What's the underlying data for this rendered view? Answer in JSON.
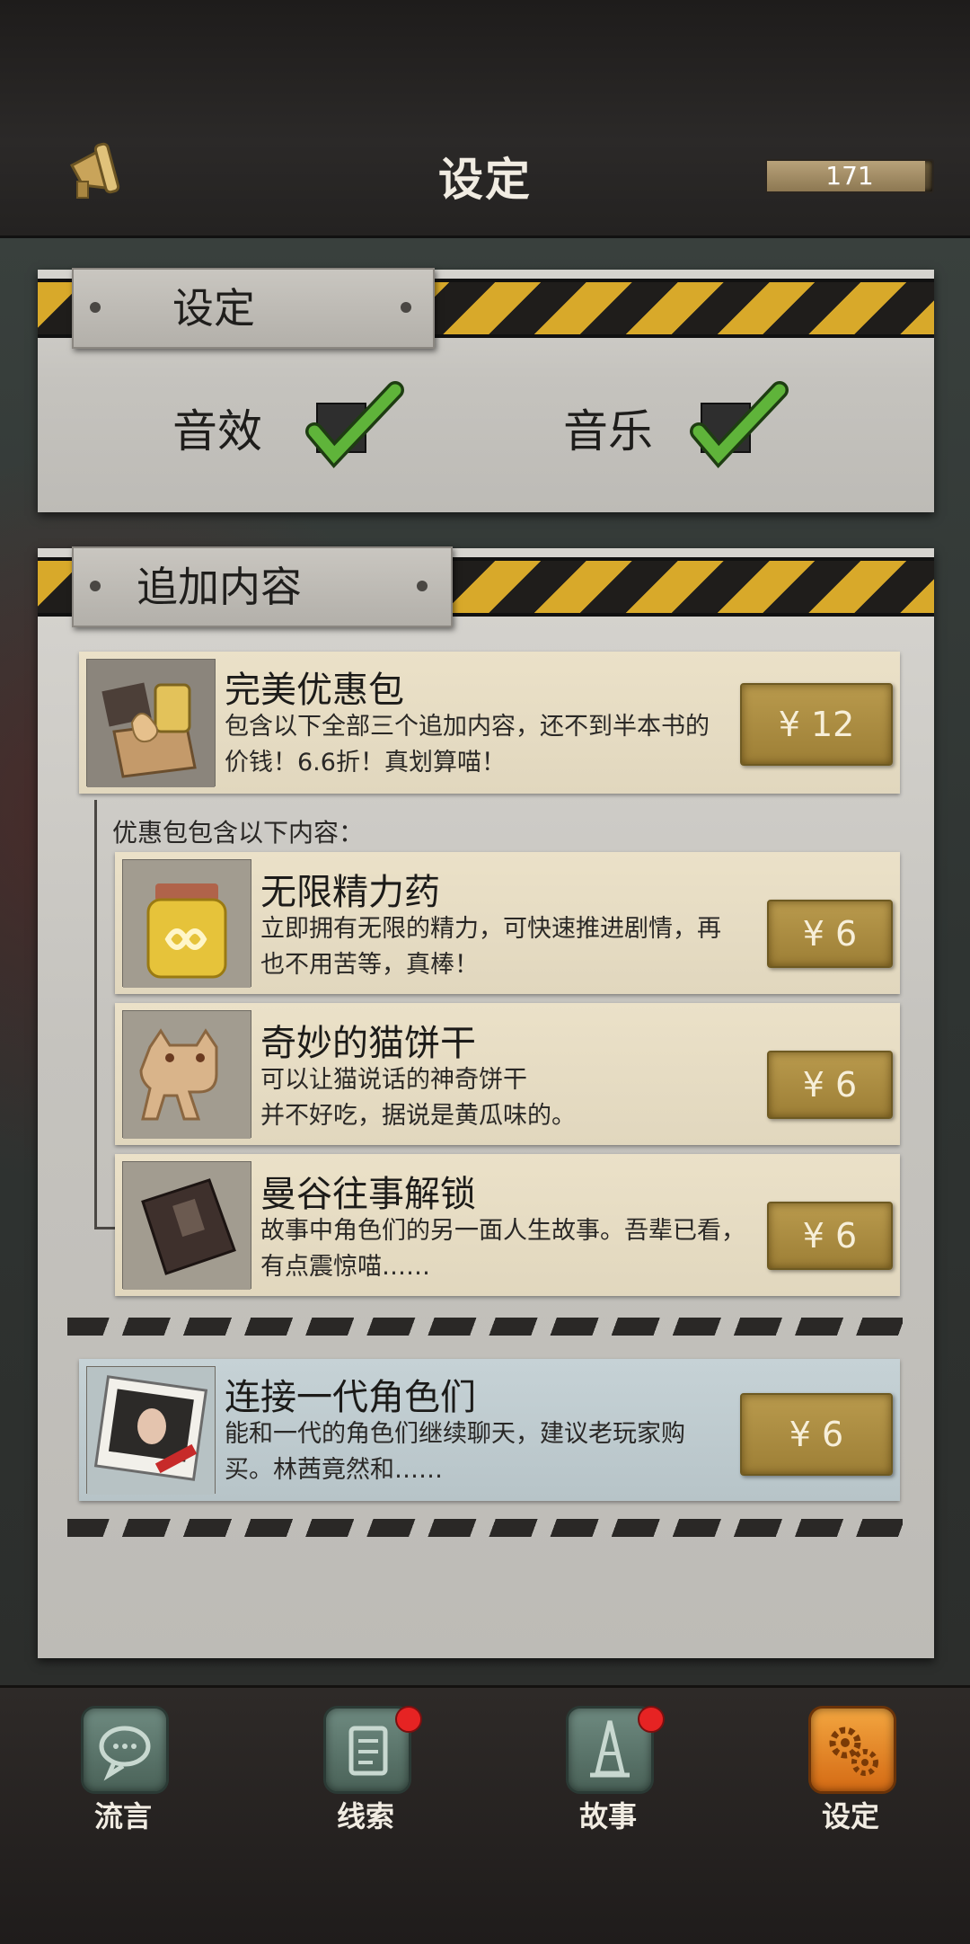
{
  "header": {
    "title": "设定",
    "coins": "171"
  },
  "settings": {
    "heading": "设定",
    "sound_label": "音效",
    "music_label": "音乐",
    "sound_on": true,
    "music_on": true
  },
  "addons": {
    "heading": "追加内容",
    "bundle": {
      "title": "完美优惠包",
      "desc": "包含以下全部三个追加内容，还不到半本书的价钱！6.6折！真划算喵！",
      "price": "¥ 12"
    },
    "bundle_includes_label": "优惠包包含以下内容：",
    "items": [
      {
        "title": "无限精力药",
        "desc": "立即拥有无限的精力，可快速推进剧情，再也不用苦等，真棒！",
        "price": "¥ 6"
      },
      {
        "title": "奇妙的猫饼干",
        "desc": "可以让猫说话的神奇饼干\n并不好吃，据说是黄瓜味的。",
        "price": "¥ 6"
      },
      {
        "title": "曼谷往事解锁",
        "desc": "故事中角色们的另一面人生故事。吾辈已看，有点震惊喵……",
        "price": "¥ 6"
      }
    ],
    "connect": {
      "title": "连接一代角色们",
      "desc": "能和一代的角色们继续聊天，建议老玩家购买。林茜竟然和……",
      "price": "¥ 6"
    }
  },
  "nav": {
    "items": [
      {
        "label": "流言",
        "badge": false,
        "active": false
      },
      {
        "label": "线索",
        "badge": true,
        "active": false
      },
      {
        "label": "故事",
        "badge": true,
        "active": false
      },
      {
        "label": "设定",
        "badge": false,
        "active": true
      }
    ]
  },
  "colors": {
    "accent_gold": "#b99a4d",
    "hazard_yellow": "#d8a92a",
    "active_tab": "#f3a640",
    "badge_red": "#e62323"
  }
}
